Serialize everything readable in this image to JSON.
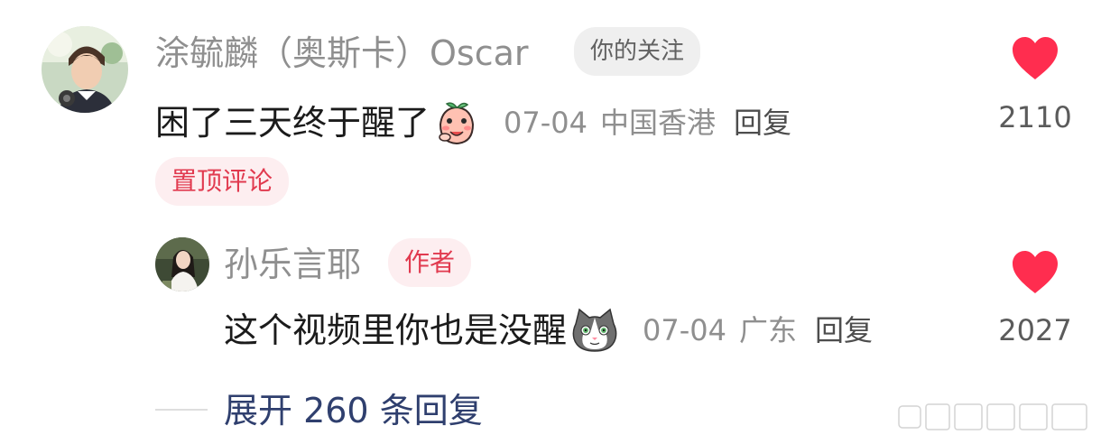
{
  "main_comment": {
    "username": "涂毓麟（奥斯卡）Oscar",
    "follow_badge": "你的关注",
    "text": "困了三天终于醒了",
    "emoji_icon": "peach-face-emoji",
    "date": "07-04",
    "location": "中国香港",
    "reply_label": "回复",
    "pinned_label": "置顶评论",
    "like_count": "2110",
    "like_color": "#ff2d4f"
  },
  "reply": {
    "username": "孙乐言耶",
    "author_badge": "作者",
    "text": "这个视频里你也是没醒",
    "emoji_icon": "cat-face-emoji",
    "date": "07-04",
    "location": "广东",
    "reply_label": "回复",
    "like_count": "2027"
  },
  "expand": {
    "label": "展开 260 条回复"
  },
  "colors": {
    "accent_red": "#ff2d4f",
    "badge_red_text": "#e13a4f",
    "badge_red_bg": "#fdeef0",
    "expand_blue": "#2f3f6e",
    "muted_gray": "#8f8f8f"
  }
}
